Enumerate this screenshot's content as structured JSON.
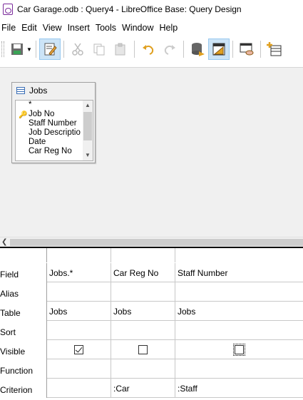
{
  "window": {
    "title": "Car Garage.odb : Query4 - LibreOffice Base: Query Design"
  },
  "menu": [
    "File",
    "Edit",
    "View",
    "Insert",
    "Tools",
    "Window",
    "Help"
  ],
  "toolbar": {
    "icons": [
      "save-icon",
      "edit-design-icon",
      "cut-icon",
      "copy-icon",
      "paste-icon",
      "undo-icon",
      "redo-icon",
      "run-query-icon",
      "design-view-icon",
      "sql-view-icon",
      "add-table-icon"
    ]
  },
  "table_window": {
    "title": "Jobs",
    "fields": [
      {
        "label": "*",
        "key": false
      },
      {
        "label": "Job No",
        "key": true
      },
      {
        "label": "Staff Number",
        "key": false
      },
      {
        "label": "Job Descriptio",
        "key": false
      },
      {
        "label": "Date",
        "key": false
      },
      {
        "label": "Car Reg No",
        "key": false
      }
    ]
  },
  "grid": {
    "row_labels": {
      "field": "Field",
      "alias": "Alias",
      "table": "Table",
      "sort": "Sort",
      "visible": "Visible",
      "function": "Function",
      "criterion": "Criterion"
    },
    "columns": [
      {
        "field": "Jobs.*",
        "alias": "",
        "table": "Jobs",
        "sort": "",
        "visible": true,
        "function": "",
        "criterion": ""
      },
      {
        "field": "Car Reg No",
        "alias": "",
        "table": "Jobs",
        "sort": "",
        "visible": false,
        "function": "",
        "criterion": ":Car"
      },
      {
        "field": "Staff Number",
        "alias": "",
        "table": "Jobs",
        "sort": "",
        "visible": false,
        "function": "",
        "criterion": ":Staff"
      }
    ]
  }
}
